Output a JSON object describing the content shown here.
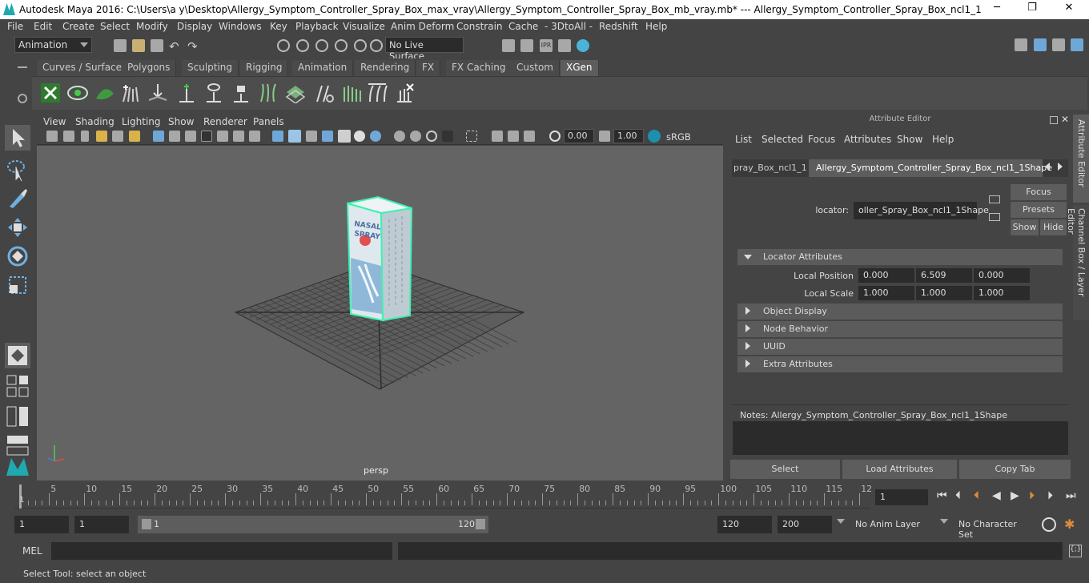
{
  "app": {
    "title": "Autodesk Maya 2016: C:\\Users\\a y\\Desktop\\Allergy_Symptom_Controller_Spray_Box_max_vray\\Allergy_Symptom_Controller_Spray_Box_mb_vray.mb*   ---   Allergy_Symptom_Controller_Spray_Box_ncl1_1"
  },
  "window": {
    "minimize": "─",
    "maximize": "❐",
    "close": "✕"
  },
  "menu": [
    "File",
    "Edit",
    "Create",
    "Select",
    "Modify",
    "Display",
    "Windows",
    "Key",
    "Playback",
    "Visualize",
    "Anim Deform",
    "Constrain",
    "Cache",
    "- 3DtoAll -",
    "Redshift",
    "Help"
  ],
  "toolbar": {
    "mode": "Animation",
    "live_surface": "No Live Surface"
  },
  "shelf_tabs": [
    "Curves / Surfaces",
    "Polygons",
    "Sculpting",
    "Rigging",
    "Animation",
    "Rendering",
    "FX",
    "FX Caching",
    "Custom",
    "XGen"
  ],
  "shelf_active": "XGen",
  "viewport": {
    "menu": [
      "View",
      "Shading",
      "Lighting",
      "Show",
      "Renderer",
      "Panels"
    ],
    "exposure": "0.00",
    "gamma": "1.00",
    "color_space": "sRGB gamma",
    "camera": "persp"
  },
  "attr_editor": {
    "title": "Attribute Editor",
    "menu": [
      "List",
      "Selected",
      "Focus",
      "Attributes",
      "Show",
      "Help"
    ],
    "tab_inactive": "pray_Box_ncl1_1",
    "tab_active": "Allergy_Symptom_Controller_Spray_Box_ncl1_1Shape",
    "locator_label": "locator:",
    "locator_value": "oller_Spray_Box_ncl1_1Shape",
    "buttons": {
      "focus": "Focus",
      "presets": "Presets",
      "show": "Show",
      "hide": "Hide"
    },
    "sections": {
      "locator_attributes": "Locator Attributes",
      "object_display": "Object Display",
      "node_behavior": "Node Behavior",
      "uuid": "UUID",
      "extra_attributes": "Extra Attributes"
    },
    "local_position": {
      "label": "Local Position",
      "x": "0.000",
      "y": "6.509",
      "z": "0.000"
    },
    "local_scale": {
      "label": "Local Scale",
      "x": "1.000",
      "y": "1.000",
      "z": "1.000"
    },
    "notes": "Notes:  Allergy_Symptom_Controller_Spray_Box_ncl1_1Shape",
    "bottom": {
      "select": "Select",
      "load": "Load Attributes",
      "copy": "Copy Tab"
    }
  },
  "side_tabs": {
    "attribute_editor": "Attribute Editor",
    "channel_box": "Channel Box / Layer Editor"
  },
  "timeline": {
    "ticks": [
      "5",
      "10",
      "15",
      "20",
      "25",
      "30",
      "35",
      "40",
      "45",
      "50",
      "55",
      "60",
      "65",
      "70",
      "75",
      "80",
      "85",
      "90",
      "95",
      "100",
      "105",
      "110",
      "115",
      "12"
    ],
    "start": "1",
    "current": "1"
  },
  "range": {
    "start": "1",
    "start2": "1",
    "slider_start": "1",
    "slider_end": "120",
    "end": "120",
    "end2": "200",
    "anim_layer": "No Anim Layer",
    "char_set": "No Character Set"
  },
  "command": {
    "label": "MEL"
  },
  "status": "Select Tool: select an object",
  "box_label": {
    "line1": "NASAL",
    "line2": "SPRAY"
  }
}
